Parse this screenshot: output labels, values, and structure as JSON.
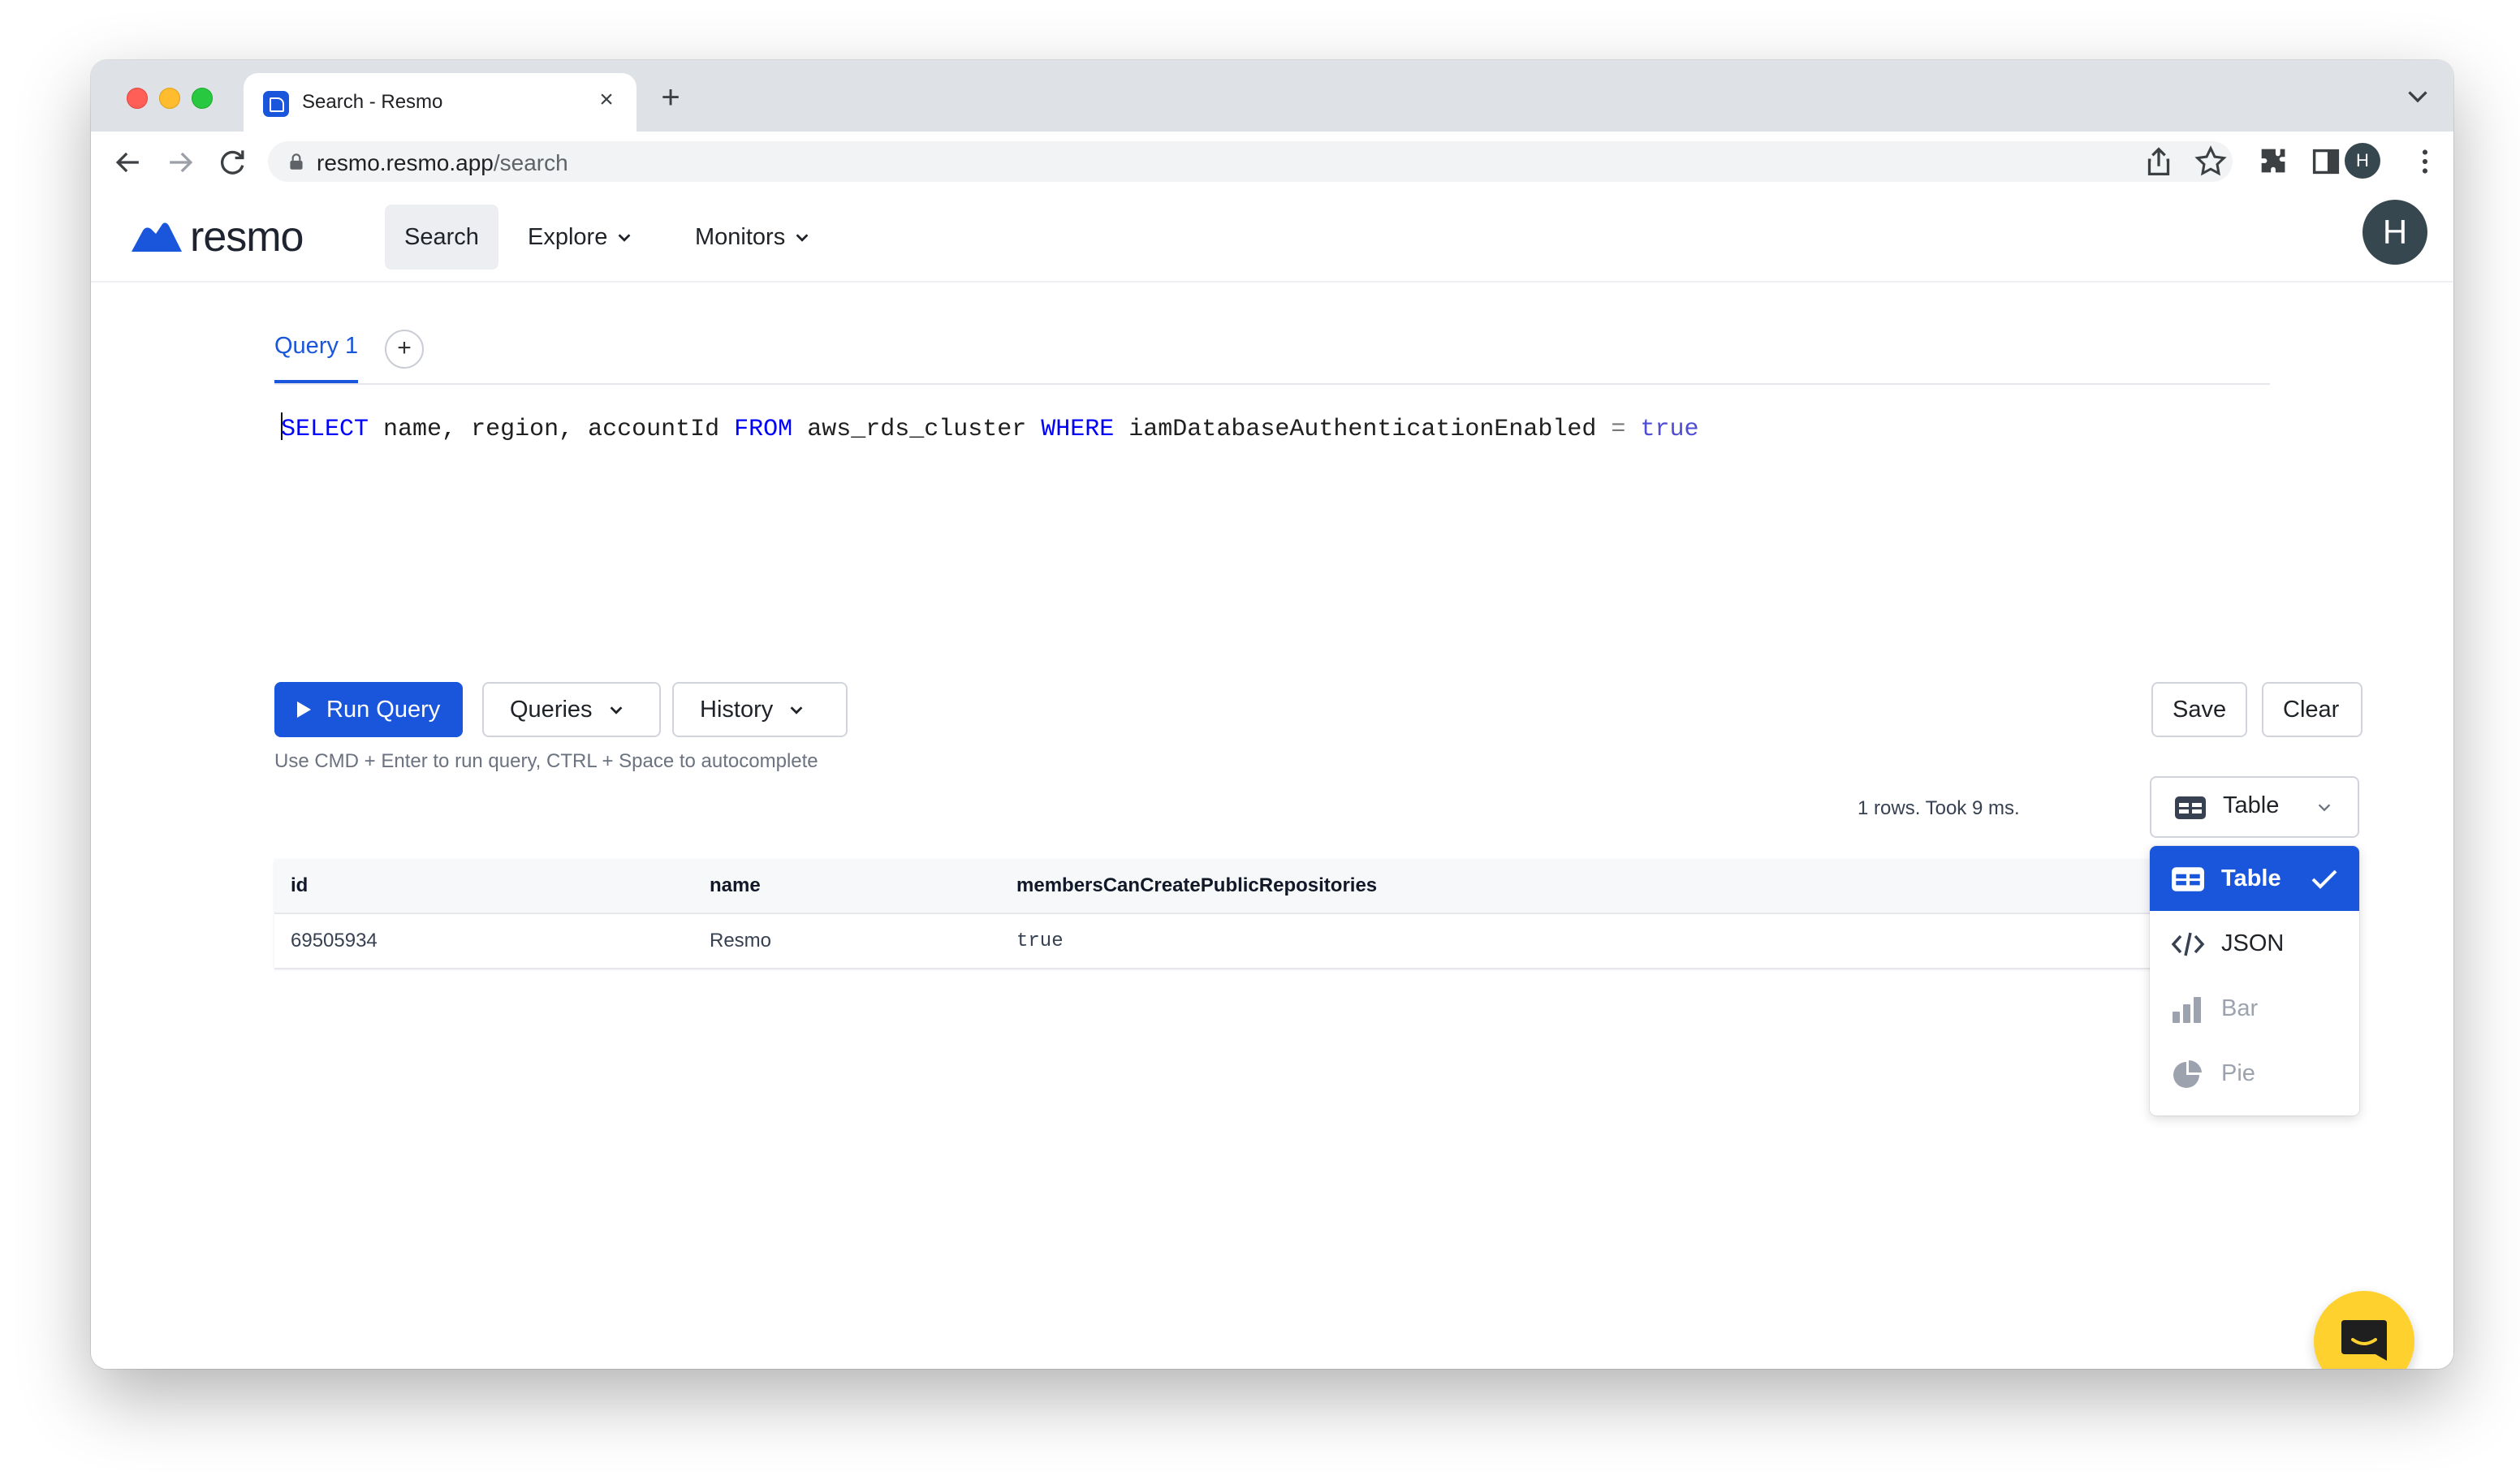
{
  "browser": {
    "tab_title": "Search - Resmo",
    "url_host": "resmo.resmo.app",
    "url_path": "/search",
    "profile_initial": "H"
  },
  "app": {
    "logo_text": "resmo",
    "nav": {
      "search": "Search",
      "explore": "Explore",
      "monitors": "Monitors"
    },
    "user_initial": "H"
  },
  "query": {
    "tab_label": "Query 1",
    "add_tab_label": "+",
    "sql_tokens": [
      "SELECT",
      "name,",
      "region,",
      "accountId",
      "FROM",
      "aws_rds_cluster",
      "WHERE",
      "iamDatabaseAuthenticationEnabled",
      "=",
      "true"
    ]
  },
  "actions": {
    "run_query": "Run Query",
    "queries": "Queries",
    "history": "History",
    "save": "Save",
    "clear": "Clear",
    "hint": "Use CMD + Enter to run query, CTRL + Space to autocomplete"
  },
  "results": {
    "summary": "1 rows. Took 9 ms.",
    "view_selected": "Table",
    "columns": [
      "id",
      "name",
      "membersCanCreatePublicRepositories"
    ],
    "rows": [
      [
        "69505934",
        "Resmo",
        "true"
      ]
    ]
  },
  "view_menu": {
    "options": [
      {
        "label": "Table",
        "icon": "table-icon",
        "state": "selected"
      },
      {
        "label": "JSON",
        "icon": "code-icon",
        "state": "enabled"
      },
      {
        "label": "Bar",
        "icon": "bar-chart-icon",
        "state": "disabled"
      },
      {
        "label": "Pie",
        "icon": "pie-chart-icon",
        "state": "disabled"
      }
    ]
  },
  "colors": {
    "accent": "#1a56db",
    "chat_widget": "#ffd12e"
  }
}
